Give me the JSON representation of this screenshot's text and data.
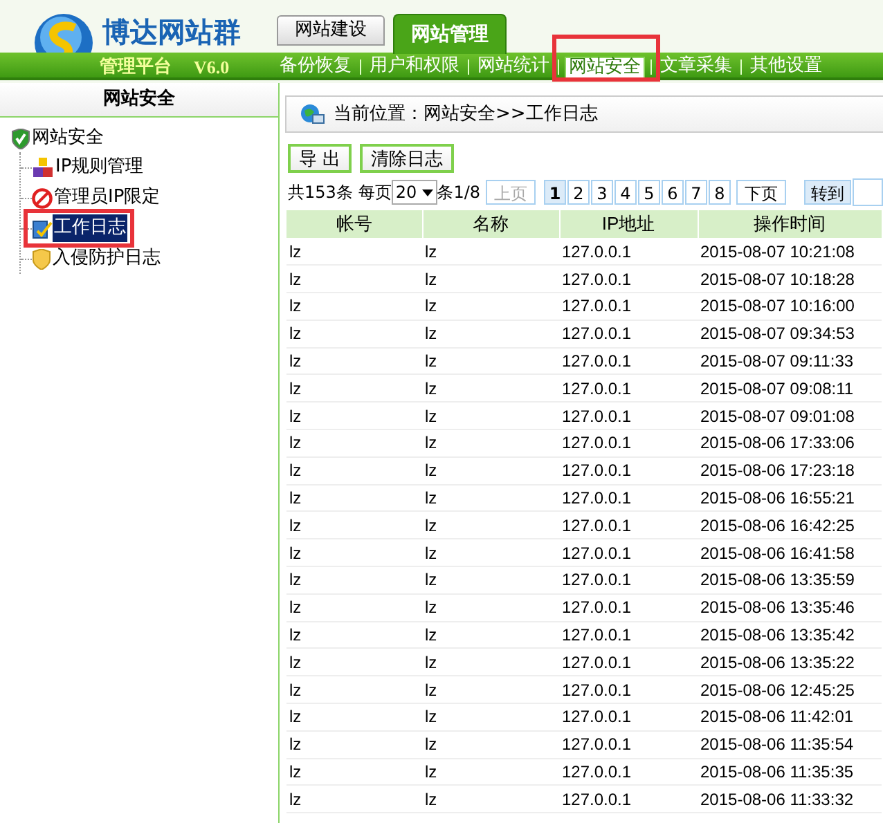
{
  "logo": {
    "name": "博达网站群",
    "subtitle": "管理平台",
    "version": "V6.0"
  },
  "tabs": [
    {
      "label": "网站建设",
      "selected": false
    },
    {
      "label": "网站管理",
      "selected": true
    }
  ],
  "nav": [
    {
      "label": "备份恢复",
      "selected": false
    },
    {
      "label": "用户和权限",
      "selected": false
    },
    {
      "label": "网站统计",
      "selected": false
    },
    {
      "label": "网站安全",
      "selected": true
    },
    {
      "label": "文章采集",
      "selected": false
    },
    {
      "label": "其他设置",
      "selected": false
    }
  ],
  "sidebar": {
    "title": "网站安全",
    "tree": {
      "label": "网站安全",
      "kind": "shield",
      "children": [
        {
          "label": "IP规则管理",
          "kind": "blocks",
          "selected": false
        },
        {
          "label": "管理员IP限定",
          "kind": "forbid",
          "selected": false
        },
        {
          "label": "工作日志",
          "kind": "log",
          "selected": true
        },
        {
          "label": "入侵防护日志",
          "kind": "guard",
          "selected": false
        }
      ]
    }
  },
  "breadcrumb": "当前位置：网站安全>>工作日志",
  "buttons": [
    "导 出",
    "清除日志"
  ],
  "pager": {
    "total": "共153条",
    "per_page_label": "每页",
    "per_page": "20",
    "unit": "条1/8",
    "prev": "上页",
    "pages": [
      {
        "label": "1",
        "selected": true
      },
      {
        "label": "2",
        "selected": false
      },
      {
        "label": "3",
        "selected": false
      },
      {
        "label": "4",
        "selected": false
      },
      {
        "label": "5",
        "selected": false
      },
      {
        "label": "6",
        "selected": false
      },
      {
        "label": "7",
        "selected": false
      },
      {
        "label": "8",
        "selected": false
      }
    ],
    "next": "下页",
    "goto": "转到"
  },
  "table": {
    "columns": [
      "帐号",
      "名称",
      "IP地址",
      "操作时间"
    ],
    "rows": [
      [
        "lz",
        "lz",
        "127.0.0.1",
        "2015-08-07 10:21:08"
      ],
      [
        "lz",
        "lz",
        "127.0.0.1",
        "2015-08-07 10:18:28"
      ],
      [
        "lz",
        "lz",
        "127.0.0.1",
        "2015-08-07 10:16:00"
      ],
      [
        "lz",
        "lz",
        "127.0.0.1",
        "2015-08-07 09:34:53"
      ],
      [
        "lz",
        "lz",
        "127.0.0.1",
        "2015-08-07 09:11:33"
      ],
      [
        "lz",
        "lz",
        "127.0.0.1",
        "2015-08-07 09:08:11"
      ],
      [
        "lz",
        "lz",
        "127.0.0.1",
        "2015-08-07 09:01:08"
      ],
      [
        "lz",
        "lz",
        "127.0.0.1",
        "2015-08-06 17:33:06"
      ],
      [
        "lz",
        "lz",
        "127.0.0.1",
        "2015-08-06 17:23:18"
      ],
      [
        "lz",
        "lz",
        "127.0.0.1",
        "2015-08-06 16:55:21"
      ],
      [
        "lz",
        "lz",
        "127.0.0.1",
        "2015-08-06 16:42:25"
      ],
      [
        "lz",
        "lz",
        "127.0.0.1",
        "2015-08-06 16:41:58"
      ],
      [
        "lz",
        "lz",
        "127.0.0.1",
        "2015-08-06 13:35:59"
      ],
      [
        "lz",
        "lz",
        "127.0.0.1",
        "2015-08-06 13:35:46"
      ],
      [
        "lz",
        "lz",
        "127.0.0.1",
        "2015-08-06 13:35:42"
      ],
      [
        "lz",
        "lz",
        "127.0.0.1",
        "2015-08-06 13:35:22"
      ],
      [
        "lz",
        "lz",
        "127.0.0.1",
        "2015-08-06 12:45:25"
      ],
      [
        "lz",
        "lz",
        "127.0.0.1",
        "2015-08-06 11:42:01"
      ],
      [
        "lz",
        "lz",
        "127.0.0.1",
        "2015-08-06 11:35:54"
      ],
      [
        "lz",
        "lz",
        "127.0.0.1",
        "2015-08-06 11:35:35"
      ],
      [
        "lz",
        "lz",
        "127.0.0.1",
        "2015-08-06 11:33:32"
      ]
    ]
  }
}
